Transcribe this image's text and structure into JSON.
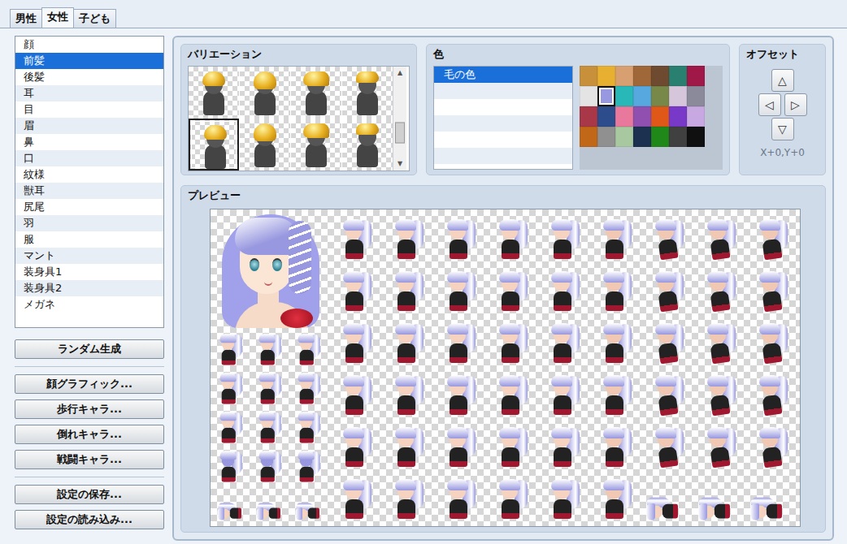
{
  "tabs": [
    {
      "label": "男性",
      "selected": false
    },
    {
      "label": "女性",
      "selected": true
    },
    {
      "label": "子ども",
      "selected": false
    }
  ],
  "parts": [
    {
      "label": "顔",
      "selected": false
    },
    {
      "label": "前髪",
      "selected": true
    },
    {
      "label": "後髪",
      "selected": false
    },
    {
      "label": "耳",
      "selected": false
    },
    {
      "label": "目",
      "selected": false
    },
    {
      "label": "眉",
      "selected": false
    },
    {
      "label": "鼻",
      "selected": false
    },
    {
      "label": "口",
      "selected": false
    },
    {
      "label": "紋様",
      "selected": false
    },
    {
      "label": "獣耳",
      "selected": false
    },
    {
      "label": "尻尾",
      "selected": false
    },
    {
      "label": "羽",
      "selected": false
    },
    {
      "label": "服",
      "selected": false
    },
    {
      "label": "マント",
      "selected": false
    },
    {
      "label": "装身具1",
      "selected": false
    },
    {
      "label": "装身具2",
      "selected": false
    },
    {
      "label": "メガネ",
      "selected": false
    }
  ],
  "actions": {
    "random": "ランダム生成",
    "exports": [
      "顔グラフィック...",
      "歩行キャラ...",
      "倒れキャラ...",
      "戦闘キャラ..."
    ],
    "files": [
      "設定の保存...",
      "設定の読み込み..."
    ]
  },
  "variation": {
    "title": "バリエーション",
    "items": [
      {
        "selected": false
      },
      {
        "selected": false
      },
      {
        "selected": false
      },
      {
        "selected": false
      },
      {
        "selected": true
      },
      {
        "selected": false
      },
      {
        "selected": false
      },
      {
        "selected": false
      }
    ],
    "scroll_up": "▲",
    "scroll_down": "▼",
    "scrollbar": {
      "level": 0.75
    }
  },
  "color": {
    "title": "色",
    "items": [
      {
        "label": "毛の色",
        "selected": true
      }
    ],
    "palette": [
      {
        "color": "#c8903a",
        "selected": false
      },
      {
        "color": "#e8b030",
        "selected": false
      },
      {
        "color": "#d8a070",
        "selected": false
      },
      {
        "color": "#a06838",
        "selected": false
      },
      {
        "color": "#6e4a30",
        "selected": false
      },
      {
        "color": "#2a8070",
        "selected": false
      },
      {
        "color": "#a01848",
        "selected": false
      },
      {
        "color": "#e4e4e4",
        "selected": false
      },
      {
        "color": "#9898e0",
        "selected": true
      },
      {
        "color": "#28b8b8",
        "selected": false
      },
      {
        "color": "#58a8e0",
        "selected": false
      },
      {
        "color": "#788848",
        "selected": false
      },
      {
        "color": "#d6c6dc",
        "selected": false
      },
      {
        "color": "#8a8a9a",
        "selected": false
      },
      {
        "color": "#a83848",
        "selected": false
      },
      {
        "color": "#2c4c8c",
        "selected": false
      },
      {
        "color": "#e8789c",
        "selected": false
      },
      {
        "color": "#9050b0",
        "selected": false
      },
      {
        "color": "#e05818",
        "selected": false
      },
      {
        "color": "#7838c8",
        "selected": false
      },
      {
        "color": "#c8a8e0",
        "selected": false
      },
      {
        "color": "#c06818",
        "selected": false
      },
      {
        "color": "#909090",
        "selected": false
      },
      {
        "color": "#a8c8a0",
        "selected": false
      },
      {
        "color": "#1c3050",
        "selected": false
      },
      {
        "color": "#208818",
        "selected": false
      },
      {
        "color": "#404040",
        "selected": false
      },
      {
        "color": "#101010",
        "selected": false
      }
    ]
  },
  "offset": {
    "title": "オフセット",
    "buttons": [
      "△",
      "◁",
      "▷",
      "▽"
    ],
    "reading": "X+0,Y+0"
  },
  "preview": {
    "title": "プレビュー"
  }
}
